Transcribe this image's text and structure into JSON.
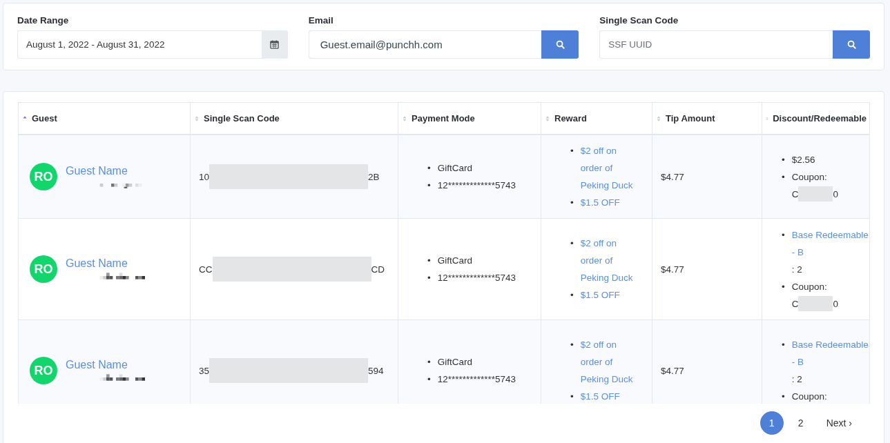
{
  "filters": {
    "date_range": {
      "label": "Date Range",
      "value": "August 1, 2022 - August 31, 2022"
    },
    "email": {
      "label": "Email",
      "value": "Guest.email@punchh.com"
    },
    "scan_code": {
      "label": "Single Scan Code",
      "placeholder": "SSF UUID"
    }
  },
  "table": {
    "bullet": "•",
    "columns": [
      {
        "label": "Guest",
        "sorted": true
      },
      {
        "label": "Single Scan Code",
        "sorted": false
      },
      {
        "label": "Payment Mode",
        "sorted": false
      },
      {
        "label": "Reward",
        "sorted": false
      },
      {
        "label": "Tip Amount",
        "sorted": false
      },
      {
        "label": "Discount/Redeemable",
        "sorted": false
      }
    ],
    "rows": [
      {
        "guest": {
          "initials": "RO",
          "name": "Guest Name"
        },
        "scan_code": {
          "start": "10",
          "end": "2B"
        },
        "payment": [
          "GiftCard",
          "12*************5743"
        ],
        "reward": [
          "$2 off on order of Peking Duck",
          "$1.5 OFF"
        ],
        "tip": "$4.77",
        "discount": [
          {
            "kind": "text",
            "text": "$2.56"
          },
          {
            "kind": "coupon",
            "text": "Coupon:",
            "code_start": "C",
            "code_end": "0"
          }
        ]
      },
      {
        "guest": {
          "initials": "RO",
          "name": "Guest Name"
        },
        "scan_code": {
          "start": "CC",
          "end": "CD"
        },
        "payment": [
          "GiftCard",
          "12*************5743"
        ],
        "reward": [
          "$2 off on order of Peking Duck",
          "$1.5 OFF"
        ],
        "tip": "$4.77",
        "discount": [
          {
            "kind": "link",
            "text": "Base Redeemable - B",
            "suffix": ": 2"
          },
          {
            "kind": "coupon",
            "text": "Coupon:",
            "code_start": "C",
            "code_end": "0"
          }
        ]
      },
      {
        "guest": {
          "initials": "RO",
          "name": "Guest Name"
        },
        "scan_code": {
          "start": "35",
          "end": "594"
        },
        "payment": [
          "GiftCard",
          "12*************5743"
        ],
        "reward": [
          "$2 off on order of Peking Duck",
          "$1.5 OFF"
        ],
        "tip": "$4.77",
        "discount": [
          {
            "kind": "link",
            "text": "Base Redeemable - B",
            "suffix": ": 2"
          },
          {
            "kind": "coupon",
            "text": "Coupon:"
          }
        ]
      }
    ]
  },
  "pagination": {
    "pages": [
      {
        "label": "1",
        "selected": true
      },
      {
        "label": "2",
        "selected": false
      }
    ],
    "next": "Next ›"
  }
}
